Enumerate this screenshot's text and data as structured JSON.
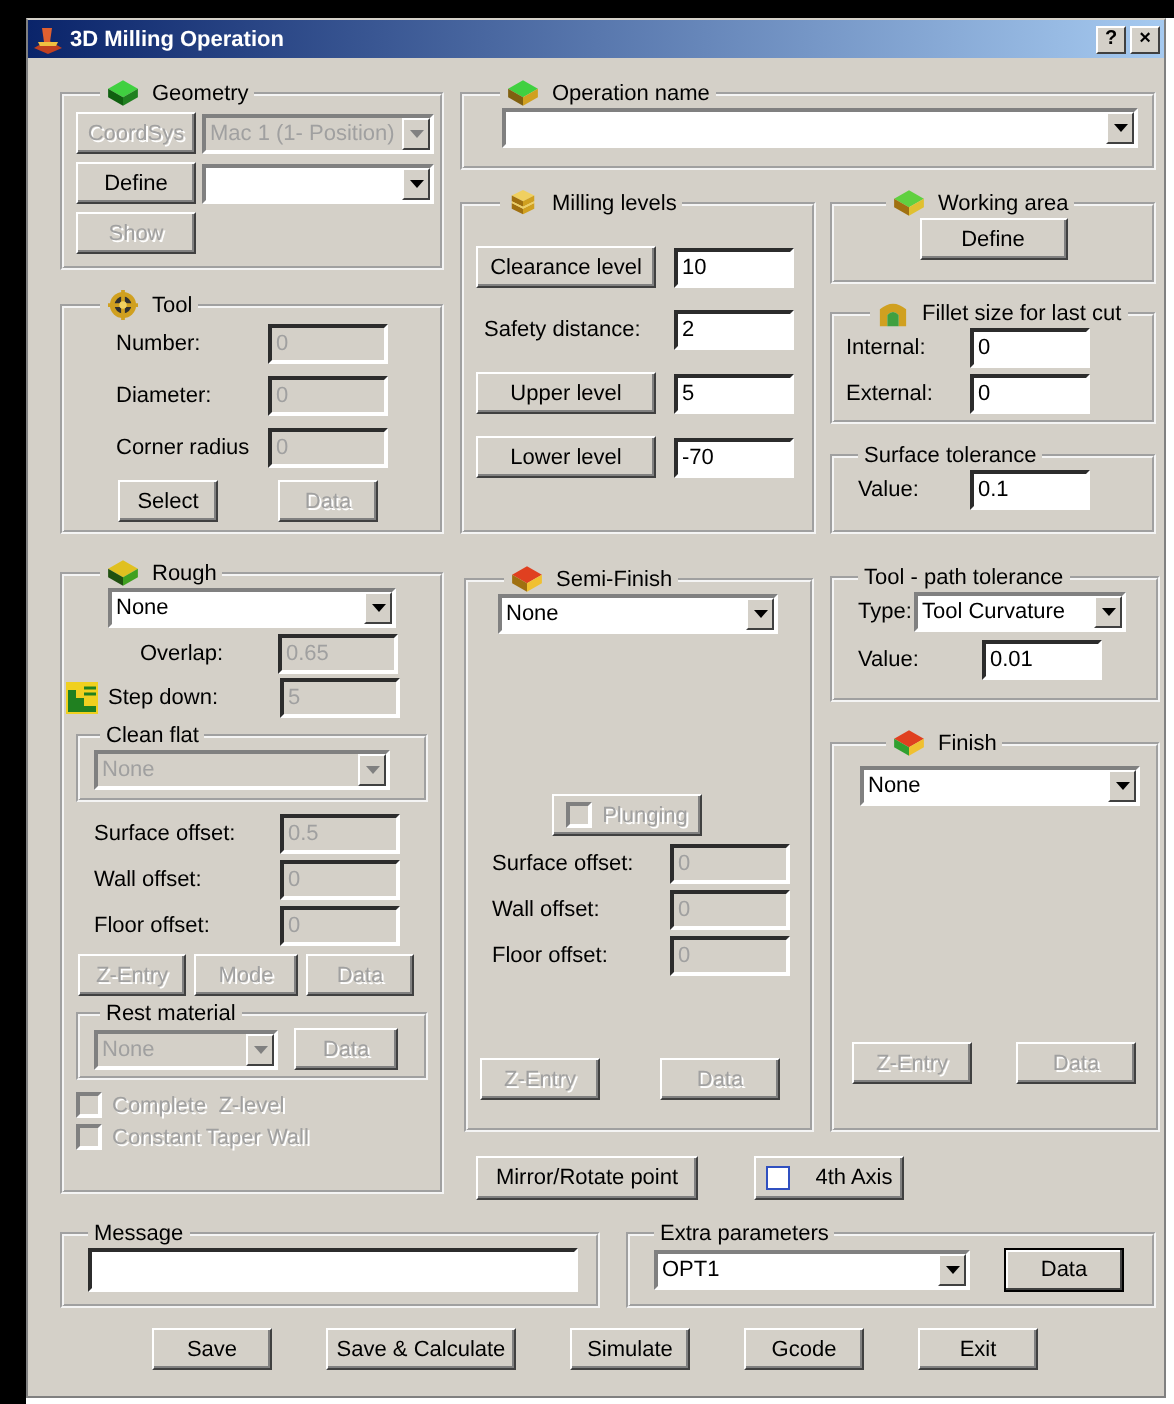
{
  "window": {
    "title": "3D Milling Operation",
    "help_button": "?",
    "close_button": "×"
  },
  "geometry": {
    "title": "Geometry",
    "coordsys_button": {
      "label": "CoordSys",
      "disabled": true
    },
    "coordsys_select": {
      "value": "Mac 1 (1- Position)",
      "disabled": true
    },
    "define_button": {
      "label": "Define",
      "disabled": false
    },
    "define_select": {
      "disabled": false
    },
    "show_button": {
      "label": "Show",
      "disabled": true
    }
  },
  "tool": {
    "title": "Tool",
    "fields": [
      {
        "label": "Number:",
        "value": "0",
        "disabled": true
      },
      {
        "label": "Diameter:",
        "value": "0",
        "disabled": true
      },
      {
        "label": "Corner radius",
        "value": "0",
        "disabled": true
      }
    ],
    "buttons": [
      {
        "label": "Select",
        "disabled": false
      },
      {
        "label": "Data",
        "disabled": true
      }
    ]
  },
  "rough": {
    "title": "Rough",
    "select": {
      "value": "None",
      "disabled": false
    },
    "overlap": {
      "label": "Overlap:",
      "value": "0.65",
      "disabled": true
    },
    "step_down": {
      "label": "Step down:",
      "value": "5",
      "disabled": true
    },
    "clean_flat": {
      "title": "Clean flat",
      "select": {
        "value": "None",
        "disabled": true
      }
    },
    "offsets": [
      {
        "label": "Surface offset:",
        "value": "0.5",
        "disabled": true
      },
      {
        "label": "Wall offset:",
        "value": "0",
        "disabled": true
      },
      {
        "label": "Floor offset:",
        "value": "0",
        "disabled": true
      }
    ],
    "buttons": [
      {
        "label": "Z-Entry",
        "disabled": true
      },
      {
        "label": "Mode",
        "disabled": true
      },
      {
        "label": "Data",
        "disabled": true
      }
    ],
    "rest_material": {
      "title": "Rest material",
      "select": {
        "value": "None",
        "disabled": true
      },
      "button": {
        "label": "Data",
        "disabled": true
      }
    },
    "checkboxes": [
      {
        "label": "Complete  Z-level",
        "checked": false,
        "disabled": true
      },
      {
        "label": "Constant Taper Wall",
        "checked": false,
        "disabled": true
      }
    ]
  },
  "operation_name": {
    "title": "Operation name",
    "select": {
      "disabled": false
    }
  },
  "milling_levels": {
    "title": "Milling levels",
    "rows": [
      {
        "kind": "button",
        "label": "Clearance level",
        "value": "10"
      },
      {
        "kind": "label",
        "label": "Safety distance:",
        "value": "2"
      },
      {
        "kind": "button",
        "label": "Upper level",
        "value": "5"
      },
      {
        "kind": "button",
        "label": "Lower level",
        "value": "-70"
      }
    ]
  },
  "working_area": {
    "title": "Working area",
    "button": {
      "label": "Define",
      "disabled": false
    }
  },
  "fillet": {
    "title": "Fillet size for last cut",
    "fields": [
      {
        "label": "Internal:",
        "value": "0",
        "disabled": false
      },
      {
        "label": "External:",
        "value": "0",
        "disabled": false
      }
    ]
  },
  "surface_tolerance": {
    "title": "Surface tolerance",
    "fields": [
      {
        "label": "Value:",
        "value": "0.1",
        "disabled": false
      }
    ]
  },
  "semi_finish": {
    "title": "Semi-Finish",
    "select": {
      "value": "None",
      "disabled": false
    },
    "plunging": {
      "label": "Plunging",
      "checked": false,
      "disabled": true
    },
    "offsets": [
      {
        "label": "Surface offset:",
        "value": "0",
        "disabled": true
      },
      {
        "label": "Wall offset:",
        "value": "0",
        "disabled": true
      },
      {
        "label": "Floor offset:",
        "value": "0",
        "disabled": true
      }
    ],
    "buttons": [
      {
        "label": "Z-Entry",
        "disabled": true
      },
      {
        "label": "Data",
        "disabled": true
      }
    ]
  },
  "tool_path_tolerance": {
    "title": "Tool - path tolerance",
    "type": {
      "label": "Type:",
      "value": "Tool Curvature",
      "disabled": false
    },
    "fields": [
      {
        "label": "Value:",
        "value": "0.01",
        "disabled": false
      }
    ]
  },
  "finish": {
    "title": "Finish",
    "select": {
      "value": "None",
      "disabled": false
    },
    "buttons": [
      {
        "label": "Z-Entry",
        "disabled": true
      },
      {
        "label": "Data",
        "disabled": true
      }
    ]
  },
  "mirror_button": {
    "label": "Mirror/Rotate point",
    "disabled": false
  },
  "fourth_axis": {
    "label": "4th Axis",
    "checked": false,
    "disabled": false
  },
  "message": {
    "title": "Message"
  },
  "extra_parameters": {
    "title": "Extra parameters",
    "select": {
      "value": "OPT1",
      "disabled": false
    },
    "button": {
      "label": "Data",
      "disabled": false
    }
  },
  "buttons": [
    {
      "label": "Save"
    },
    {
      "label": "Save & Calculate"
    },
    {
      "label": "Simulate"
    },
    {
      "label": "Gcode"
    },
    {
      "label": "Exit"
    }
  ]
}
